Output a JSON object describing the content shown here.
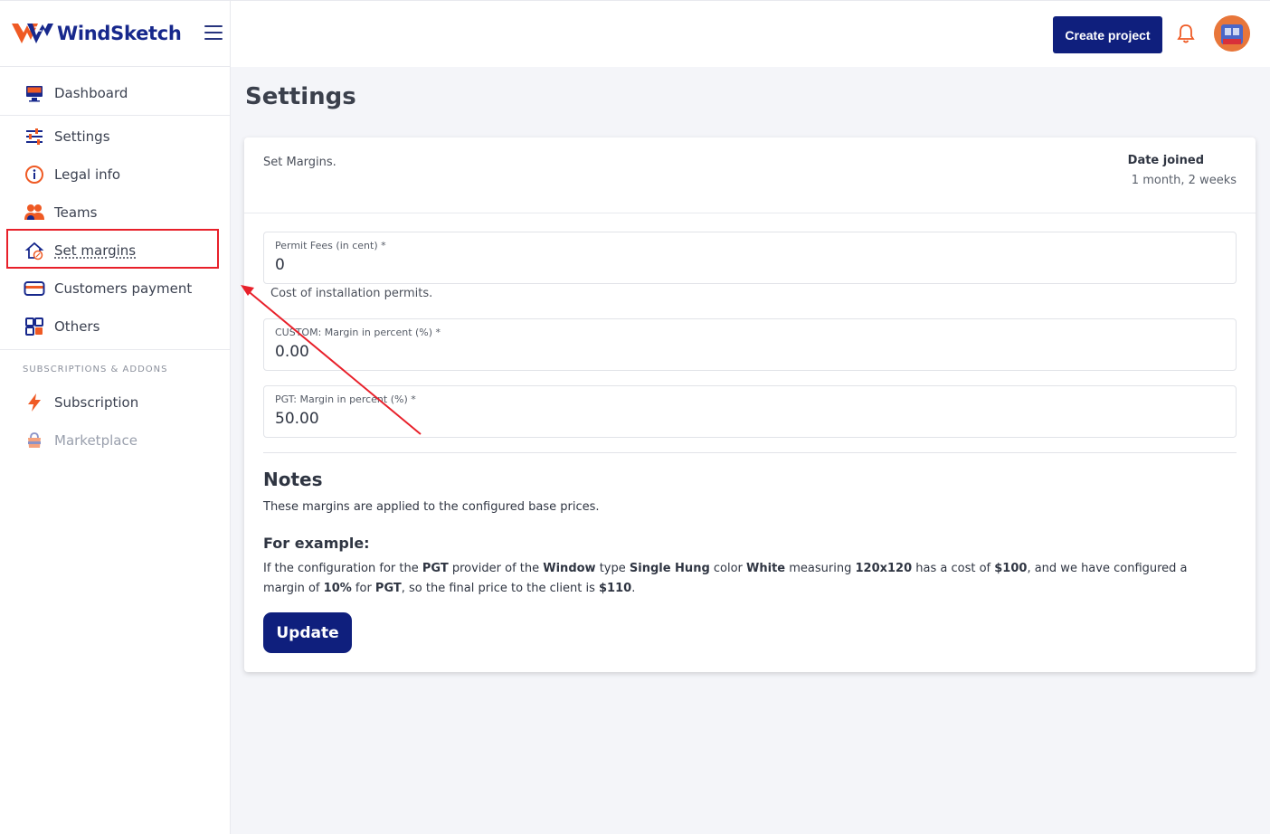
{
  "app": {
    "name": "WindSketch"
  },
  "sidebar": {
    "items": [
      {
        "label": "Dashboard",
        "icon": "monitor-icon"
      },
      {
        "label": "Settings",
        "icon": "sliders-icon"
      },
      {
        "label": "Legal info",
        "icon": "info-icon"
      },
      {
        "label": "Teams",
        "icon": "users-icon"
      },
      {
        "label": "Set margins",
        "icon": "home-percent-icon",
        "active": true
      },
      {
        "label": "Customers payment",
        "icon": "credit-card-icon"
      },
      {
        "label": "Others",
        "icon": "grid-icon"
      }
    ],
    "section_title": "SUBSCRIPTIONS & ADDONS",
    "addons": [
      {
        "label": "Subscription",
        "icon": "lightning-icon"
      },
      {
        "label": "Marketplace",
        "icon": "shopping-bag-icon"
      }
    ]
  },
  "topbar": {
    "create_label": "Create project"
  },
  "page": {
    "title": "Settings"
  },
  "card": {
    "subtitle": "Set Margins.",
    "joined_label": "Date joined",
    "joined_value": "1 month, 2 weeks"
  },
  "form": {
    "permit": {
      "label": "Permit Fees (in cent) *",
      "value": "0",
      "help": "Cost of installation permits."
    },
    "custom": {
      "label": "CUSTOM: Margin in percent (%) *",
      "value": "0.00"
    },
    "pgt": {
      "label": "PGT: Margin in percent (%) *",
      "value": "50.00"
    }
  },
  "notes": {
    "title": "Notes",
    "text": "These margins are applied to the configured base prices.",
    "example_title": "For example:",
    "example": {
      "t1": "If the configuration for the ",
      "b1": "PGT",
      "t2": " provider of the ",
      "b2": "Window",
      "t3": " type ",
      "b3": "Single Hung",
      "t4": " color ",
      "b4": "White",
      "t5": " measuring ",
      "b5": "120x120",
      "t6": " has a cost of ",
      "b6": "$100",
      "t7": ", and we have configured a margin of ",
      "b7": "10%",
      "t8": " for ",
      "b8": "PGT",
      "t9": ", so the final price to the client is ",
      "b9": "$110",
      "t10": "."
    },
    "update_label": "Update"
  },
  "colors": {
    "brand": "#17288c",
    "primary_button": "#0f1f7d",
    "accent_orange": "#ef6b2f",
    "annotation_red": "#e8202a"
  }
}
